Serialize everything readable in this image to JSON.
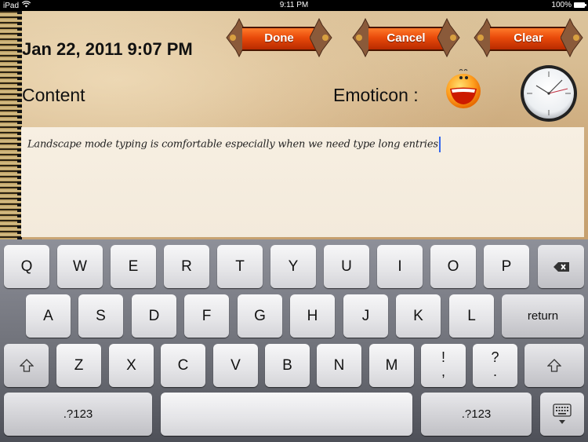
{
  "status_bar": {
    "device": "iPad",
    "time": "9:11 PM",
    "battery": "100%"
  },
  "toolbar": {
    "done_label": "Done",
    "cancel_label": "Cancel",
    "clear_label": "Clear"
  },
  "entry": {
    "datetime": "Jan 22, 2011 9:07 PM",
    "content_label": "Content",
    "emoticon_label": "Emoticon :",
    "text": "Landscape mode typing is comfortable especially when we need type long entries"
  },
  "colors": {
    "button_orange": "#e84a0a",
    "caret_blue": "#3366ee",
    "paper": "#d4b68a"
  },
  "keyboard": {
    "row1": [
      "Q",
      "W",
      "E",
      "R",
      "T",
      "Y",
      "U",
      "I",
      "O",
      "P"
    ],
    "row2": [
      "A",
      "S",
      "D",
      "F",
      "G",
      "H",
      "J",
      "K",
      "L"
    ],
    "return_label": "return",
    "row3": [
      "Z",
      "X",
      "C",
      "V",
      "B",
      "N",
      "M"
    ],
    "punct1": {
      "top": "!",
      "bottom": ","
    },
    "punct2": {
      "top": "?",
      "bottom": "."
    },
    "numbers_label": ".?123"
  }
}
